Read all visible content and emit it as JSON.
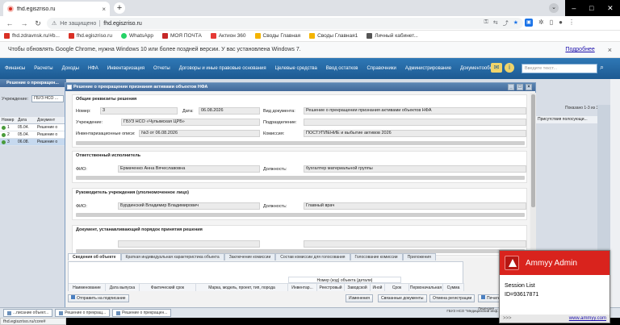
{
  "browser": {
    "tab_title": "fhd.egiszriso.ru",
    "tab_close": "×",
    "new_tab": "+",
    "insecure_label": "Не защищено",
    "url": "fhd.egiszriso.ru",
    "status_url": "fhd.egiszriso.ru/core#"
  },
  "bookmarks": [
    {
      "label": "fhd.zdravnsk.ru/#b...",
      "color": "#d93025"
    },
    {
      "label": "fhd.egiszriso.ru",
      "color": "#d93025"
    },
    {
      "label": "WhatsApp",
      "color": "#25d366"
    },
    {
      "label": "МОЯ ПОЧТА",
      "color": "#c62828"
    },
    {
      "label": "Актион 360",
      "color": "#e53935"
    },
    {
      "label": "Своды Главная",
      "color": "#f4b400"
    },
    {
      "label": "Своды Главная1",
      "color": "#f4b400"
    },
    {
      "label": "Личный кабинет...",
      "color": "#555555"
    }
  ],
  "infobar": {
    "text": "Чтобы обновлять Google Chrome, нужна Windows 10 или более поздней версии. У вас установлена Windows 7.",
    "link": "Подробнее",
    "close": "×"
  },
  "menu": {
    "items": [
      "Финансы",
      "Расчеты",
      "Доходы",
      "НФА",
      "Инвентаризация",
      "Отчеты",
      "Договоры и иные правовые основания",
      "Целевые средства",
      "Ввод остатков",
      "Справочники",
      "Администрирование",
      "Документооборот"
    ],
    "search_placeholder": "Введите текст..."
  },
  "background": {
    "panel_title": "Решение о прекращен...",
    "institution_label": "Учреждение:",
    "institution_value": "ГБУЗ НСО ...",
    "columns": [
      "Номер",
      "Дата",
      "Документ"
    ],
    "rows": [
      {
        "num": "1",
        "date": "05.04.",
        "doc": "Решение о"
      },
      {
        "num": "2",
        "date": "05.04.",
        "doc": "Решение о"
      },
      {
        "num": "3",
        "date": "06.08.",
        "doc": "Решение о"
      }
    ],
    "right_header": "Присутствия полосующи...",
    "shown": "Показано 1-3 из 3"
  },
  "modal": {
    "title": "Решение о прекращении признания активами объектов НФА",
    "general": {
      "title": "Общие реквизиты решения",
      "number_label": "Номер:",
      "number_value": "3",
      "date_label": "Дата:",
      "date_value": "06.08.2026",
      "doctype_label": "Вид документа:",
      "doctype_value": "Решение о прекращении признания активами объектов НФА",
      "institution_label": "Учреждение:",
      "institution_value": "ГБУЗ НСО «Чулымская ЦРБ»",
      "department_label": "Подразделение:",
      "department_value": "",
      "inventory_label": "Инвентаризационные описи:",
      "inventory_value": "№3 от 06.08.2026",
      "commission_label": "Комиссия:",
      "commission_value": "ПОСТУПЛЕНИЕ и выбытие активов 2026"
    },
    "executor": {
      "title": "Ответственный исполнитель",
      "fio_label": "ФИО:",
      "fio_value": "Ермаченко Анна Вячеславовна",
      "position_label": "Должность:",
      "position_value": "бухгалтер материальной группы"
    },
    "head": {
      "title": "Руководитель учреждения (уполномоченное лицо)",
      "fio_label": "ФИО:",
      "fio_value": "Бурдинский Владимир Владимирович",
      "position_label": "Должность:",
      "position_value": "Главный врач"
    },
    "basis": {
      "title": "Документ, устанавливающий порядок принятия решения"
    },
    "tabs": [
      "Сведения об объекте",
      "Краткая индивидуальная характеристика объекта",
      "Заключение комиссии",
      "Состав комиссии для голосования",
      "Голосование комиссии",
      "Приложения"
    ],
    "grid": {
      "group": "Номер (код) объекта (детали)",
      "columns": [
        "Наименование",
        "Дата выпуска",
        "Фактический срок",
        "Марка, модель, проект, тип, порода",
        "Инвентар...",
        "Реестровый",
        "Заводской",
        "Иной",
        "Срок",
        "Первоначальная",
        "Сумма"
      ]
    },
    "buttons": {
      "send": "Отправить на подписание",
      "changes": "Изменения",
      "linked": "Связанные документы",
      "cancel_reg": "Отмена регистрации",
      "print": "Печать"
    }
  },
  "taskbar": {
    "items": [
      "...писание объект...",
      "Решение о прекращ...",
      "Решение о прекращен..."
    ],
    "org_top": "Лицензия ...",
    "org": "ГБУЗ НСО \"Медицинский инф..."
  },
  "ammyy": {
    "title": "Ammyy Admin",
    "session": "Session List",
    "id": "ID=93617871",
    "arrows": ">>>",
    "site": "www.ammyy.com"
  }
}
